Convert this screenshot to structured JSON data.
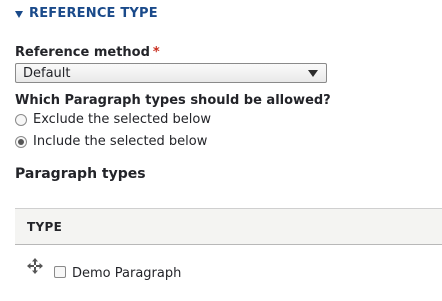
{
  "section": {
    "title": "REFERENCE TYPE",
    "icon": "triangle-down-icon"
  },
  "reference_method": {
    "label": "Reference method",
    "required_marker": "*",
    "selected": "Default"
  },
  "allowed": {
    "label": "Which Paragraph types should be allowed?",
    "options": [
      {
        "label": "Exclude the selected below",
        "checked": false
      },
      {
        "label": "Include the selected below",
        "checked": true
      }
    ]
  },
  "paragraph_types": {
    "label": "Paragraph types",
    "column_header": "TYPE",
    "rows": [
      {
        "label": "Demo Paragraph",
        "checked": false
      }
    ]
  }
}
